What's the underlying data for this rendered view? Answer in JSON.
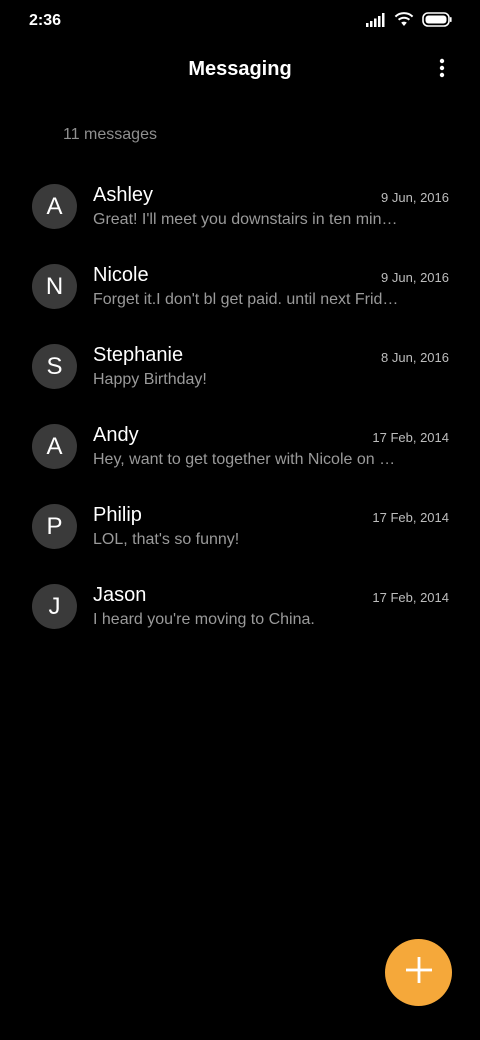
{
  "status_bar": {
    "time": "2:36",
    "icons": [
      "signal-icon",
      "wifi-icon",
      "battery-icon"
    ]
  },
  "header": {
    "title": "Messaging",
    "more_icon": "more-vertical-icon"
  },
  "message_count": "11 messages",
  "conversations": [
    {
      "initial": "A",
      "name": "Ashley",
      "date": "9 Jun, 2016",
      "preview": "Great! I'll meet you downstairs in ten min…"
    },
    {
      "initial": "N",
      "name": "Nicole",
      "date": "9 Jun, 2016",
      "preview": "Forget it.I don't bl get paid. until next Frid…"
    },
    {
      "initial": "S",
      "name": "Stephanie",
      "date": "8 Jun, 2016",
      "preview": "Happy Birthday!"
    },
    {
      "initial": "A",
      "name": "Andy",
      "date": "17 Feb, 2014",
      "preview": "Hey, want to get together with Nicole on F…"
    },
    {
      "initial": "P",
      "name": "Philip",
      "date": "17 Feb, 2014",
      "preview": "LOL, that's so funny!"
    },
    {
      "initial": "J",
      "name": "Jason",
      "date": "17 Feb, 2014",
      "preview": "I heard you're moving to China."
    }
  ],
  "fab": {
    "icon": "plus-icon",
    "color": "#f5a83a"
  },
  "colors": {
    "background": "#000000",
    "avatar": "#3a3a3a",
    "accent": "#f5a83a"
  }
}
